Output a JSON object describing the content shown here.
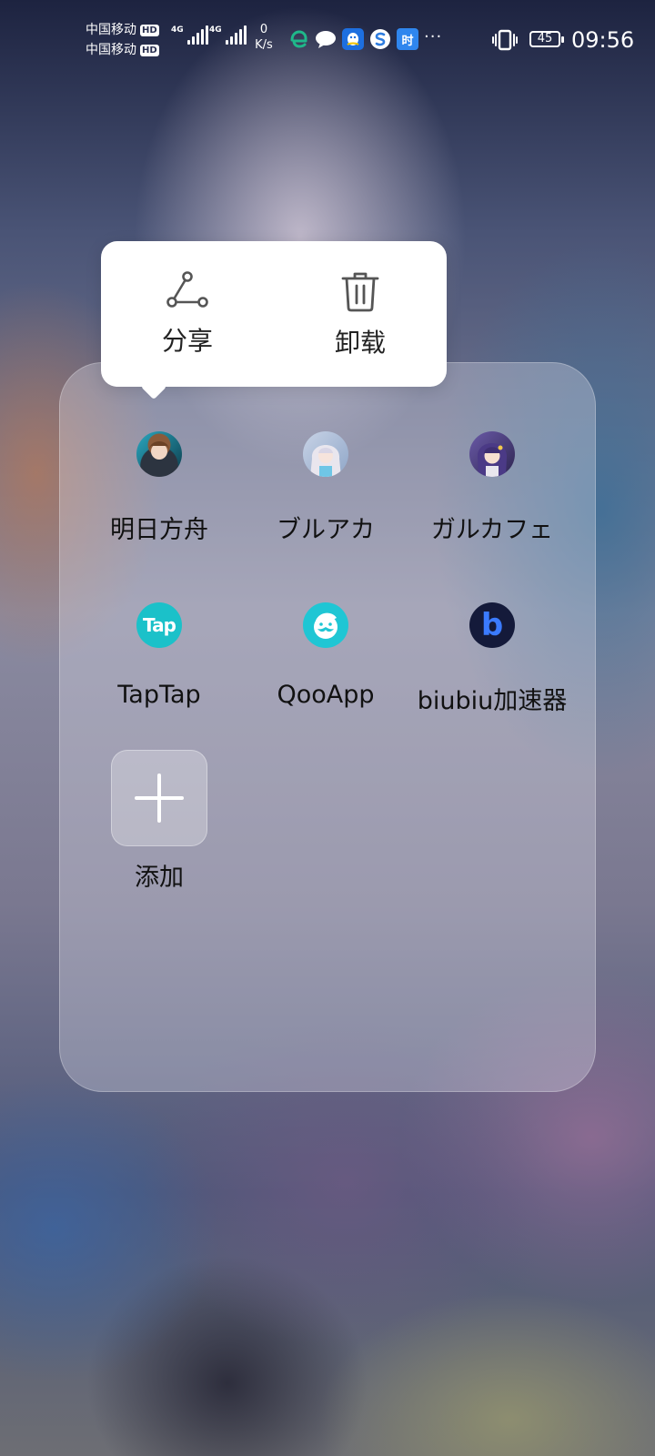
{
  "status_bar": {
    "carrier1": "中国移动",
    "carrier2": "中国移动",
    "hd_badge": "HD",
    "network1": "4G",
    "network2": "4G",
    "net_speed_value": "0",
    "net_speed_unit": "K/s",
    "notification_icons": [
      "edge-browser-icon",
      "chat-bubble-icon",
      "qq-icon",
      "sogou-icon",
      "time-app-icon"
    ],
    "time_app_glyph": "时",
    "more_indicator": "···",
    "battery_level": "45",
    "clock": "09:56"
  },
  "popup": {
    "share_label": "分享",
    "uninstall_label": "卸载"
  },
  "folder": {
    "apps": [
      {
        "name": "明日方舟"
      },
      {
        "name": "ブルアカ"
      },
      {
        "name": "ガルカフェ"
      },
      {
        "name": "TapTap",
        "icon_text": "Tap"
      },
      {
        "name": "QooApp"
      },
      {
        "name": "biubiu加速器",
        "icon_text": "b"
      }
    ],
    "add_label": "添加"
  }
}
